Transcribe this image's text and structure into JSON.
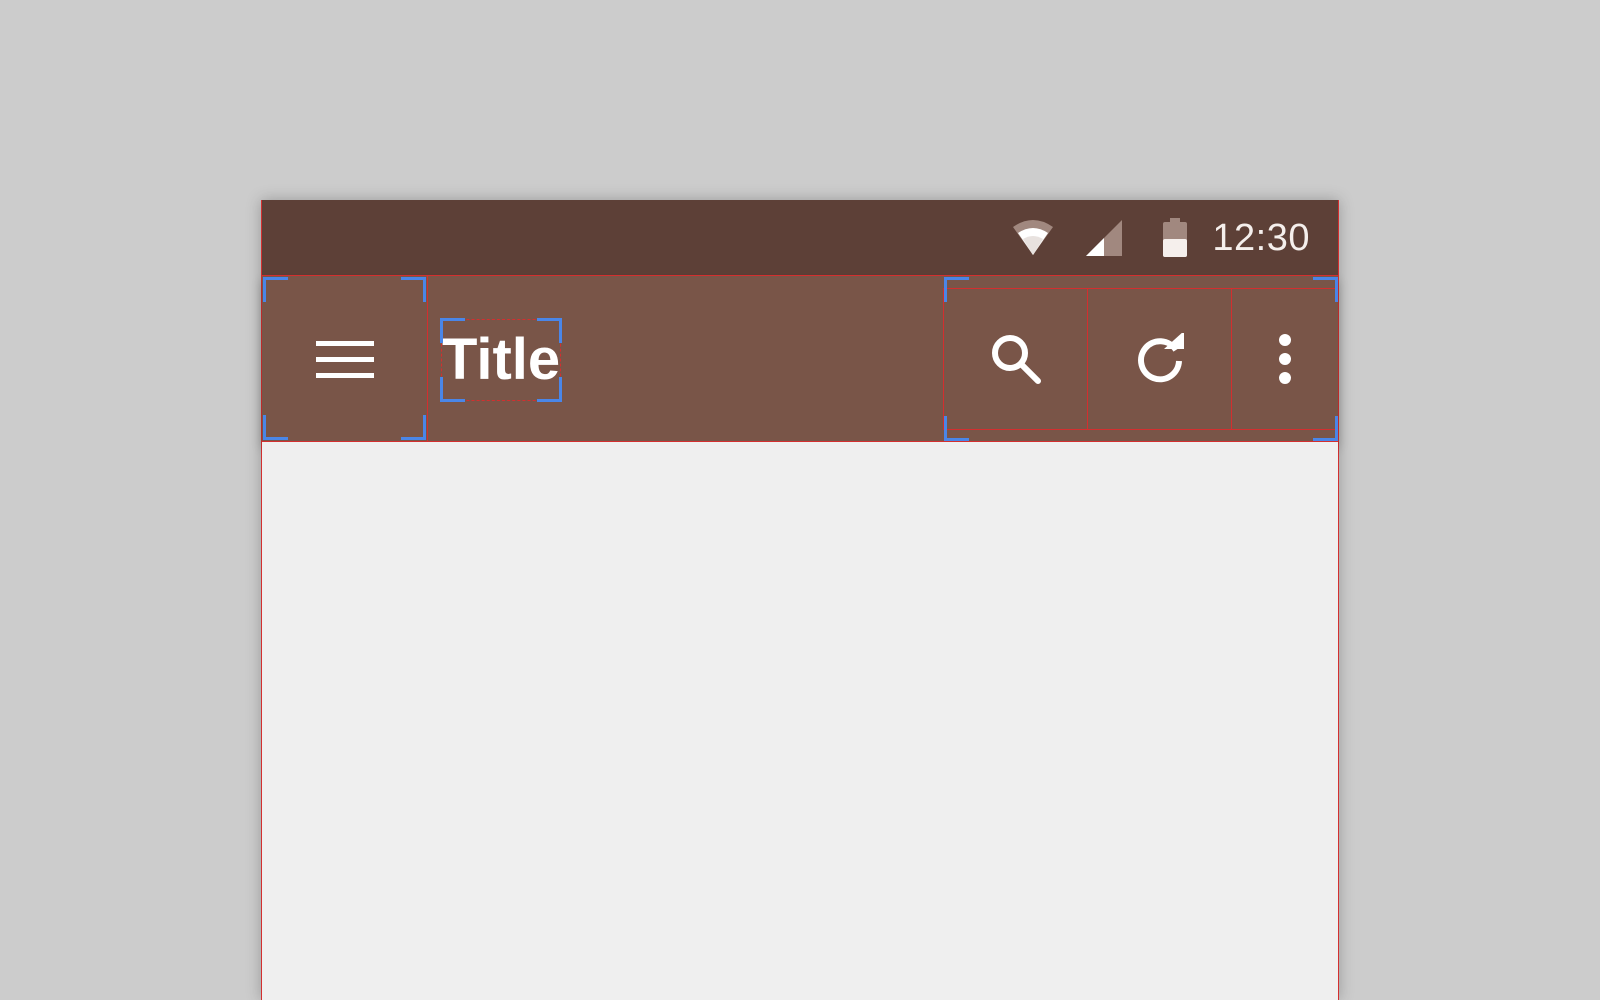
{
  "status_bar": {
    "time": "12:30",
    "icons": [
      "wifi-icon",
      "cell-signal-icon",
      "battery-icon"
    ]
  },
  "app_bar": {
    "title": "Title",
    "nav_icon": "menu-icon",
    "actions": [
      {
        "icon": "search-icon"
      },
      {
        "icon": "refresh-icon"
      },
      {
        "icon": "more-vert-icon"
      }
    ]
  },
  "colors": {
    "status_bar_bg": "#5d4037",
    "app_bar_bg": "#795548",
    "content_bg": "#efefef",
    "page_bg": "#cccccc",
    "icon_color": "#ffffff",
    "guide_red": "#d32f2f",
    "guide_blue": "#4a86e8"
  }
}
